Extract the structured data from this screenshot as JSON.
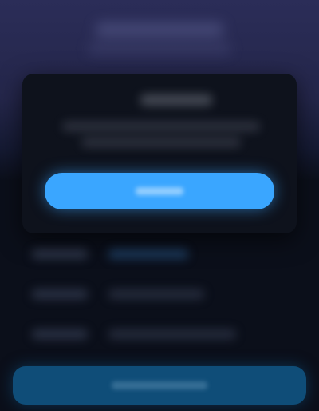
{
  "header": {
    "title": "",
    "subtitle": ""
  },
  "modal": {
    "title": "",
    "message_line1": "",
    "message_line2": "",
    "primary_button_label": ""
  },
  "details": {
    "rows": [
      {
        "label": "",
        "value": ""
      },
      {
        "label": "",
        "value": ""
      },
      {
        "label": "",
        "value": ""
      }
    ]
  },
  "footer": {
    "action_button_label": ""
  },
  "colors": {
    "background_top": "#2b2d58",
    "background_bottom": "#0b0f1a",
    "primary_button": "#3aa6ff",
    "bottom_button": "#0f4d78"
  }
}
